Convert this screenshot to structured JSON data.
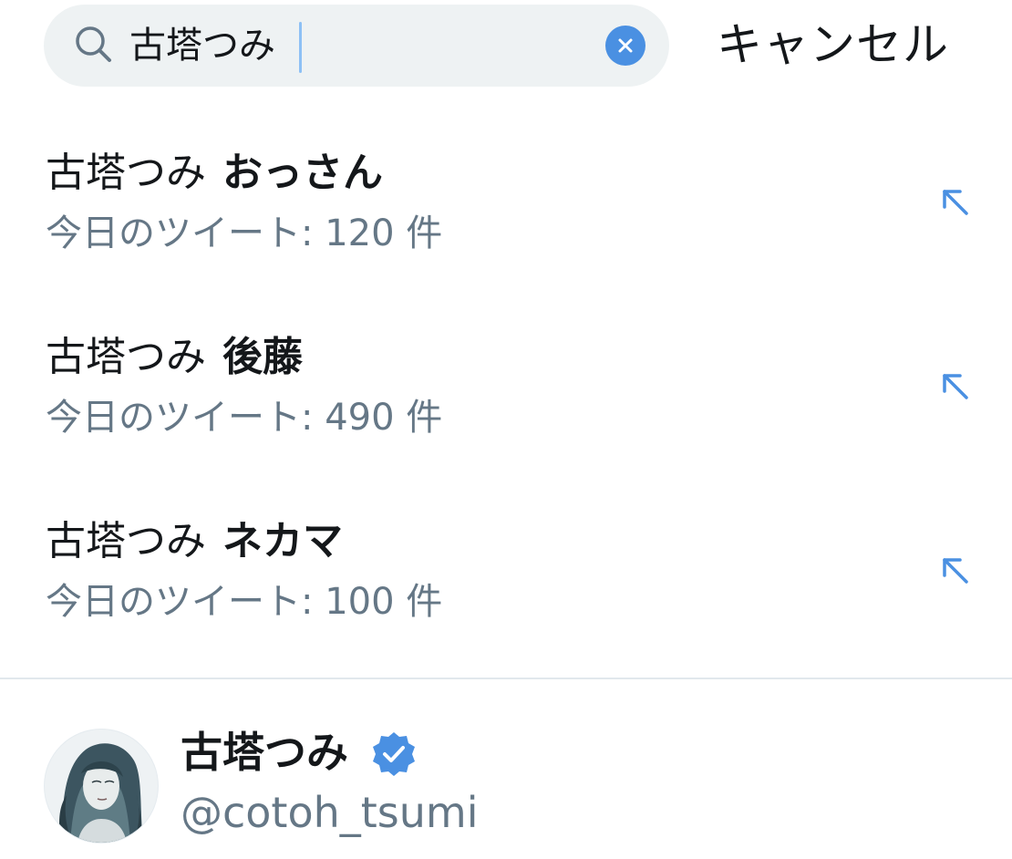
{
  "search": {
    "query": "古塔つみ",
    "cancel_label": "キャンセル"
  },
  "suggestions": [
    {
      "base": "古塔つみ",
      "term": "おっさん",
      "count": "今日のツイート: 120 件"
    },
    {
      "base": "古塔つみ",
      "term": "後藤",
      "count": "今日のツイート: 490 件"
    },
    {
      "base": "古塔つみ",
      "term": "ネカマ",
      "count": "今日のツイート: 100 件"
    }
  ],
  "user": {
    "name": "古塔つみ",
    "handle": "@cotoh_tsumi",
    "verified": true
  },
  "colors": {
    "accent": "#4a90e2",
    "search_bg": "#eef2f3",
    "secondary_text": "#657786",
    "primary_text": "#14171a",
    "divider": "#e1e8ed"
  },
  "icons": {
    "search": "search-icon",
    "clear": "clear-icon",
    "fill": "arrow-up-left-icon",
    "verified": "verified-badge-icon",
    "avatar": "avatar-illustration"
  }
}
